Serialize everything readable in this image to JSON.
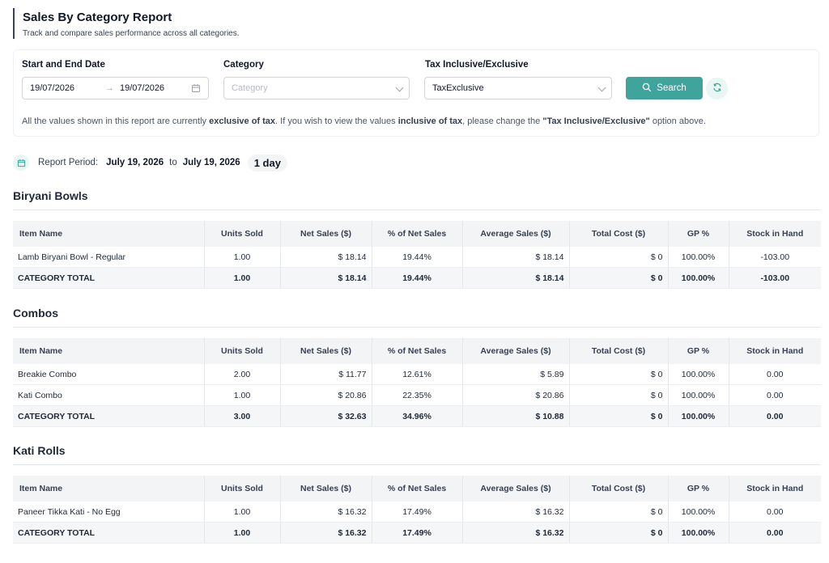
{
  "header": {
    "title": "Sales By Category Report",
    "subtitle": "Track and compare sales performance across all categories."
  },
  "filters": {
    "date_label": "Start and End Date",
    "start_date": "19/07/2026",
    "end_date": "19/07/2026",
    "arrow": "→",
    "category_label": "Category",
    "category_placeholder": "Category",
    "tax_label": "Tax Inclusive/Exclusive",
    "tax_value": "TaxExclusive",
    "search_label": "Search",
    "note_part1": "All the values shown in this report are currently ",
    "note_bold1": "exclusive of tax",
    "note_part2": ". If you wish to view the values ",
    "note_bold2": "inclusive of tax",
    "note_part3": ", please change the ",
    "note_bold3": "\"Tax Inclusive/Exclusive\"",
    "note_part4": " option above."
  },
  "period": {
    "label": "Report Period:",
    "start": "July 19, 2026",
    "to": "to",
    "end": "July 19, 2026",
    "days": "1 day"
  },
  "columns": [
    "Item Name",
    "Units Sold",
    "Net Sales ($)",
    "% of Net Sales",
    "Average Sales ($)",
    "Total Cost ($)",
    "GP %",
    "Stock in Hand"
  ],
  "categories": [
    {
      "name": "Biryani Bowls",
      "rows": [
        [
          "Lamb Biryani Bowl - Regular",
          "1.00",
          "$ 18.14",
          "19.44%",
          "$ 18.14",
          "$ 0",
          "100.00%",
          "-103.00"
        ]
      ],
      "total": [
        "CATEGORY TOTAL",
        "1.00",
        "$ 18.14",
        "19.44%",
        "$ 18.14",
        "$ 0",
        "100.00%",
        "-103.00"
      ]
    },
    {
      "name": "Combos",
      "rows": [
        [
          "Breakie Combo",
          "2.00",
          "$ 11.77",
          "12.61%",
          "$ 5.89",
          "$ 0",
          "100.00%",
          "0.00"
        ],
        [
          "Kati Combo",
          "1.00",
          "$ 20.86",
          "22.35%",
          "$ 20.86",
          "$ 0",
          "100.00%",
          "0.00"
        ]
      ],
      "total": [
        "CATEGORY TOTAL",
        "3.00",
        "$ 32.63",
        "34.96%",
        "$ 10.88",
        "$ 0",
        "100.00%",
        "0.00"
      ]
    },
    {
      "name": "Kati Rolls",
      "rows": [
        [
          "Paneer Tikka Kati - No Egg",
          "1.00",
          "$ 16.32",
          "17.49%",
          "$ 16.32",
          "$ 0",
          "100.00%",
          "0.00"
        ]
      ],
      "total": [
        "CATEGORY TOTAL",
        "1.00",
        "$ 16.32",
        "17.49%",
        "$ 16.32",
        "$ 0",
        "100.00%",
        "0.00"
      ]
    }
  ]
}
